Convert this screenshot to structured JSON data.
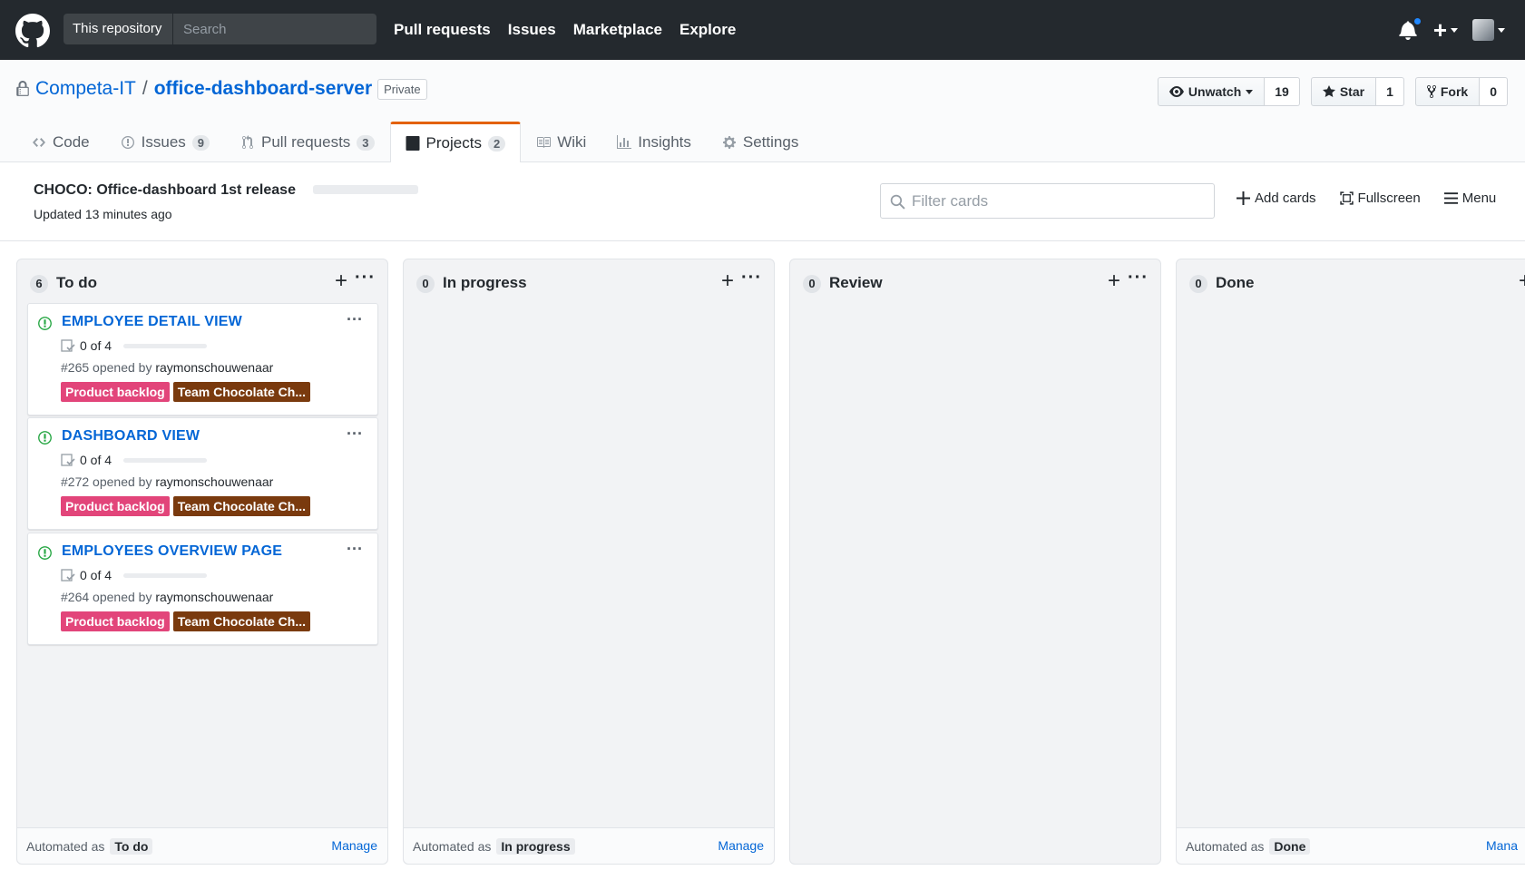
{
  "header": {
    "scope_label": "This repository",
    "search_placeholder": "Search",
    "nav": [
      "Pull requests",
      "Issues",
      "Marketplace",
      "Explore"
    ],
    "icons": [
      "github-logo-icon",
      "bell-icon",
      "plus-icon",
      "avatar"
    ]
  },
  "repo": {
    "owner": "Competa-IT",
    "separator": "/",
    "name": "office-dashboard-server",
    "visibility": "Private",
    "watch_label": "Unwatch",
    "watch_count": "19",
    "star_label": "Star",
    "star_count": "1",
    "fork_label": "Fork",
    "fork_count": "0"
  },
  "tabs": [
    {
      "label": "Code",
      "count": "",
      "icon": "code-icon"
    },
    {
      "label": "Issues",
      "count": "9",
      "icon": "issue-icon"
    },
    {
      "label": "Pull requests",
      "count": "3",
      "icon": "pull-request-icon"
    },
    {
      "label": "Projects",
      "count": "2",
      "icon": "project-icon",
      "selected": true
    },
    {
      "label": "Wiki",
      "count": "",
      "icon": "book-icon"
    },
    {
      "label": "Insights",
      "count": "",
      "icon": "graph-icon"
    },
    {
      "label": "Settings",
      "count": "",
      "icon": "gear-icon"
    }
  ],
  "project": {
    "name": "CHOCO: Office-dashboard 1st release",
    "updated": "Updated 13 minutes ago",
    "filter_placeholder": "Filter cards",
    "add_cards": "Add cards",
    "fullscreen": "Fullscreen",
    "menu": "Menu"
  },
  "columns": [
    {
      "name": "To do",
      "count": "6",
      "automated_prefix": "Automated as",
      "automated_as": "To do",
      "manage": "Manage",
      "cards": [
        {
          "title": "EMPLOYEE DETAIL VIEW",
          "tasks": "0 of 4",
          "number": "#265",
          "opened_by": "opened by",
          "author": "raymonschouwenaar"
        },
        {
          "title": "DASHBOARD VIEW",
          "tasks": "0 of 4",
          "number": "#272",
          "opened_by": "opened by",
          "author": "raymonschouwenaar"
        },
        {
          "title": "EMPLOYEES OVERVIEW PAGE",
          "tasks": "0 of 4",
          "number": "#264",
          "opened_by": "opened by",
          "author": "raymonschouwenaar"
        }
      ]
    },
    {
      "name": "In progress",
      "count": "0",
      "automated_prefix": "Automated as",
      "automated_as": "In progress",
      "manage": "Manage",
      "cards": []
    },
    {
      "name": "Review",
      "count": "0",
      "automated_prefix": "",
      "automated_as": "",
      "manage": "",
      "cards": []
    },
    {
      "name": "Done",
      "count": "0",
      "automated_prefix": "Automated as",
      "automated_as": "Done",
      "manage": "Mana",
      "cards": []
    }
  ],
  "labels": {
    "backlog": {
      "text": "Product backlog",
      "color": "#e2457a"
    },
    "team": {
      "text": "Team Chocolate Ch...",
      "color": "#7a3a0e"
    }
  },
  "colors": {
    "header_bg": "#24292e",
    "link": "#0366d6",
    "selected_tab_accent": "#e36209",
    "open_issue": "#28a745"
  }
}
